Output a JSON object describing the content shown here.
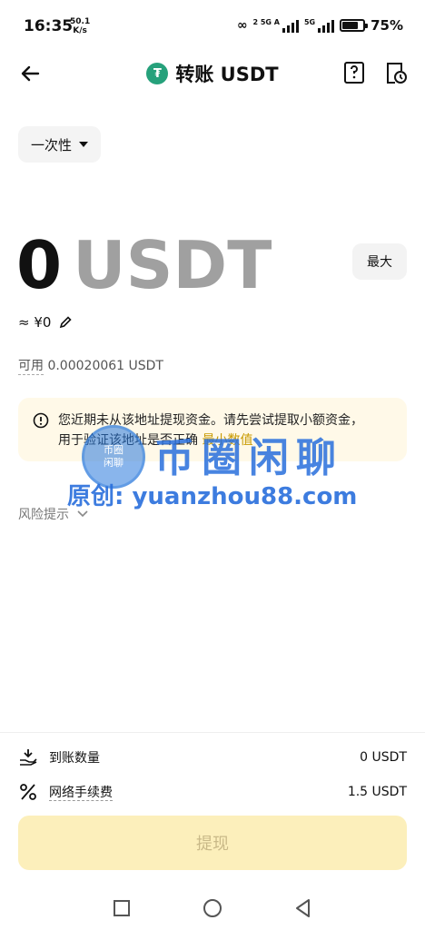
{
  "status": {
    "time": "16:35",
    "speed_value": "50.1",
    "speed_unit": "K/s",
    "net1": "2 5G A",
    "net2": "5G",
    "battery": "75%"
  },
  "header": {
    "token_symbol": "₮",
    "title": "转账 USDT"
  },
  "mode": {
    "selected": "一次性"
  },
  "amount": {
    "value": "0",
    "unit": "USDT",
    "max_label": "最大",
    "fiat": "≈ ¥0"
  },
  "available": {
    "label": "可用",
    "value": "0.00020061 USDT"
  },
  "warning": {
    "text_line1": "您近期未从该地址提现资金。请先尝试提取小额资金，",
    "text_line2": "用于验证该地址是否正确",
    "link": "最小数值"
  },
  "risk": {
    "label": "风险提示"
  },
  "watermark": {
    "seal_line1": "币圈",
    "seal_line2": "闲聊",
    "title": "币圈闲聊",
    "source": "原创: yuanzhou88.com"
  },
  "summary": {
    "received_label": "到账数量",
    "received_value": "0 USDT",
    "fee_label": "网络手续费",
    "fee_value": "1.5 USDT"
  },
  "submit_label": "提现",
  "colors": {
    "accent": "#fcefbb",
    "warn_bg": "#fff9e8",
    "token": "#26a17b"
  }
}
